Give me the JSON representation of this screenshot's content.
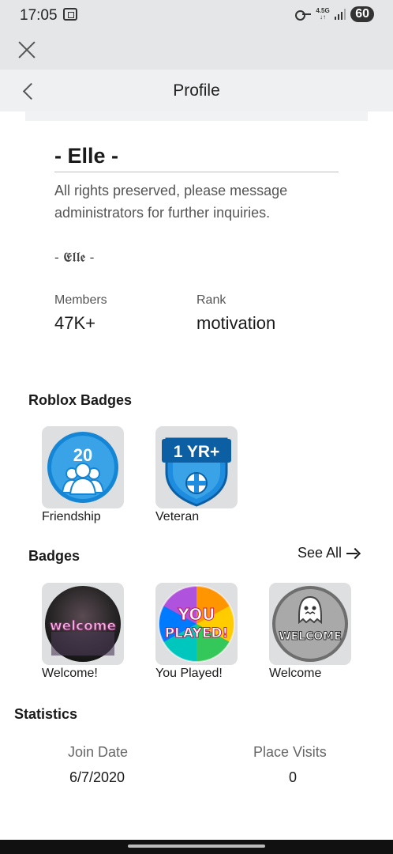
{
  "status_bar": {
    "time": "17:05",
    "network_top": "4.5G",
    "network_bottom": "↓↑",
    "battery": "60"
  },
  "nav": {
    "title": "Profile"
  },
  "group": {
    "name": "- Elle -",
    "description": "All rights preserved, please message administrators for further inquiries.",
    "signature": "- 𝕰𝖑𝖑𝖊 -",
    "members_label": "Members",
    "members_value": "47K+",
    "rank_label": "Rank",
    "rank_value": "motivation"
  },
  "roblox_badges": {
    "title": "Roblox Badges",
    "items": [
      {
        "label": "Friendship",
        "icon": "friendship-badge-icon",
        "badge_text": "20",
        "color": "#3aa3e8"
      },
      {
        "label": "Veteran",
        "icon": "veteran-badge-icon",
        "badge_text": "1 YR+",
        "color": "#1e8de0"
      }
    ]
  },
  "badges": {
    "title": "Badges",
    "see_all": "See All",
    "items": [
      {
        "label": "Welcome!",
        "icon": "welcome-badge-icon",
        "badge_text": "welcome"
      },
      {
        "label": "You Played!",
        "icon": "you-played-badge-icon",
        "badge_text_top": "YOU",
        "badge_text_bottom": "PLAYED!"
      },
      {
        "label": "Welcome",
        "icon": "ghost-welcome-badge-icon",
        "badge_text": "WELCOME"
      }
    ]
  },
  "statistics": {
    "title": "Statistics",
    "join_date_label": "Join Date",
    "join_date_value": "6/7/2020",
    "place_visits_label": "Place Visits",
    "place_visits_value": "0"
  }
}
